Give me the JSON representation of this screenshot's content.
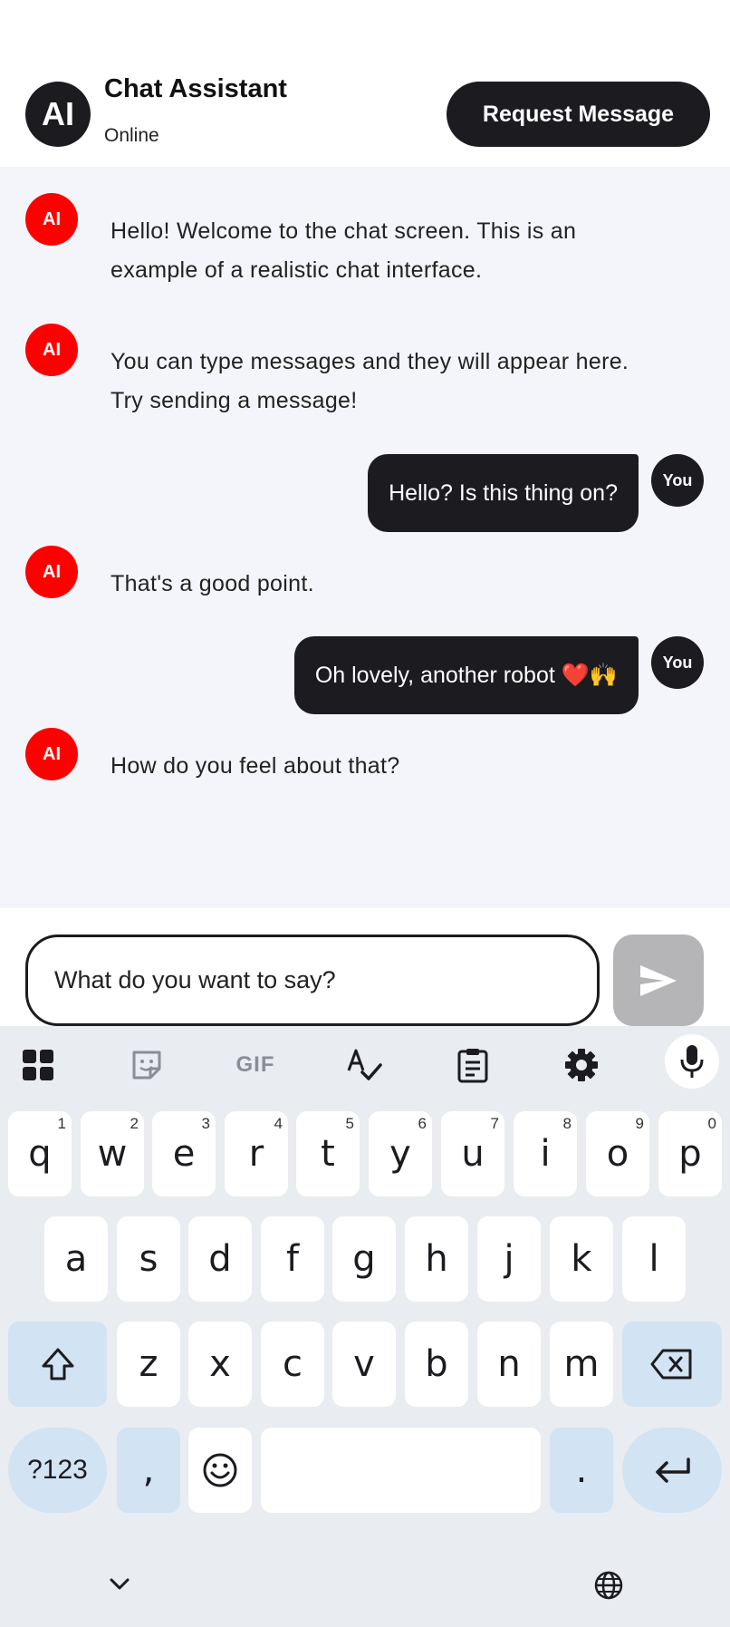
{
  "header": {
    "avatar": "AI",
    "title": "Chat Assistant",
    "status": "Online",
    "request_button": "Request Message"
  },
  "messages": [
    {
      "sender": "ai",
      "avatar": "AI",
      "lines": [
        "Hello! Welcome to the chat screen. This is an",
        "example of a realistic chat interface."
      ]
    },
    {
      "sender": "ai",
      "avatar": "AI",
      "lines": [
        "You can type messages and they will appear here.",
        "Try sending a message!"
      ]
    },
    {
      "sender": "user",
      "avatar": "You",
      "text": "Hello? Is this thing on?"
    },
    {
      "sender": "ai",
      "avatar": "AI",
      "lines": [
        "That's a good point."
      ]
    },
    {
      "sender": "user",
      "avatar": "You",
      "text": "Oh lovely, another robot ❤️🙌"
    },
    {
      "sender": "ai",
      "avatar": "AI",
      "lines": [
        "How do you feel about that?"
      ]
    }
  ],
  "composer": {
    "placeholder": "What do you want to say?",
    "send_icon": "send-icon"
  },
  "keyboard": {
    "toolbar": [
      "apps-grid-icon",
      "sticker-icon",
      "gif-icon",
      "spellcheck-icon",
      "clipboard-icon",
      "settings-gear-icon",
      "microphone-icon"
    ],
    "gif_label": "GIF",
    "row1": [
      {
        "key": "q",
        "sup": "1"
      },
      {
        "key": "w",
        "sup": "2"
      },
      {
        "key": "e",
        "sup": "3"
      },
      {
        "key": "r",
        "sup": "4"
      },
      {
        "key": "t",
        "sup": "5"
      },
      {
        "key": "y",
        "sup": "6"
      },
      {
        "key": "u",
        "sup": "7"
      },
      {
        "key": "i",
        "sup": "8"
      },
      {
        "key": "o",
        "sup": "9"
      },
      {
        "key": "p",
        "sup": "0"
      }
    ],
    "row2": [
      "a",
      "s",
      "d",
      "f",
      "g",
      "h",
      "j",
      "k",
      "l"
    ],
    "row3": [
      "z",
      "x",
      "c",
      "v",
      "b",
      "n",
      "m"
    ],
    "symbols_key": "?123",
    "comma_key": ",",
    "period_key": ".",
    "accent_color": "#d2e3f3"
  }
}
